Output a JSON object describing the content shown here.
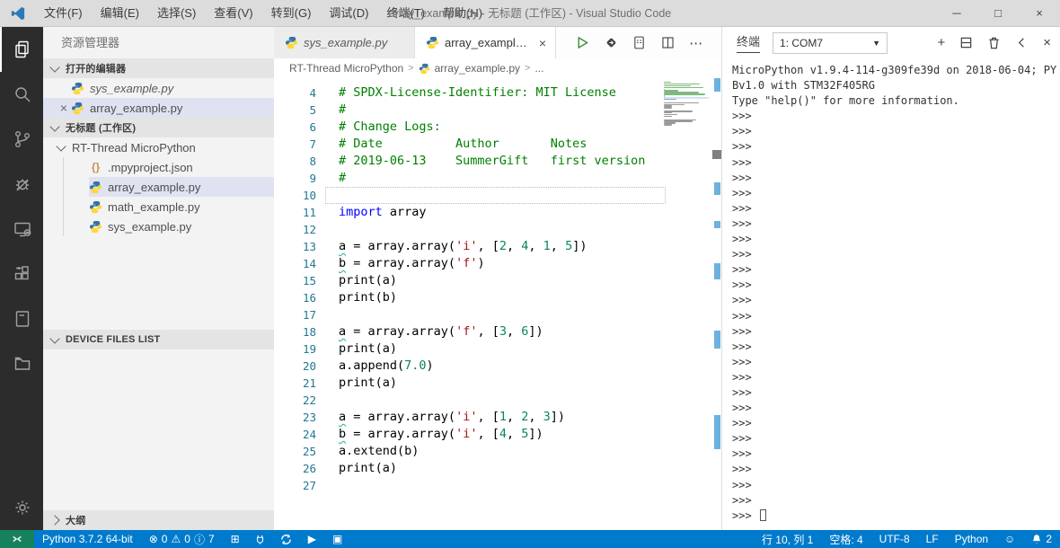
{
  "colors": {
    "accent": "#007acc",
    "remote_green": "#16825d",
    "comment_green": "#008000",
    "keyword_blue": "#0000ff",
    "string_red": "#a31515",
    "number_green": "#098658",
    "squiggle_teal": "#2aa7a4",
    "python_blue": "#3672a4",
    "python_yellow": "#fdd835"
  },
  "glyphs": {
    "close": "×",
    "minimize": "─",
    "maximize": "□",
    "dropdown_arrow": "▼",
    "plus": "+",
    "more_actions": "⋯",
    "error": "⊗",
    "warning": "⚠",
    "info": "ⓘ",
    "new_window": "⊞",
    "play": "▶",
    "stop": "▣",
    "smiley": "☺",
    "breadcrumb_sep": ">"
  },
  "title_bar": {
    "menus": [
      "文件(F)",
      "编辑(E)",
      "选择(S)",
      "查看(V)",
      "转到(G)",
      "调试(D)",
      "终端(T)",
      "帮助(H)"
    ],
    "title": "array_example.py - 无标题 (工作区) - Visual Studio Code"
  },
  "activity_bar": {
    "items": [
      {
        "name": "explorer",
        "active": true
      },
      {
        "name": "search",
        "active": false
      },
      {
        "name": "source-control",
        "active": false
      },
      {
        "name": "debug",
        "active": false
      },
      {
        "name": "device-monitor",
        "active": false
      },
      {
        "name": "extensions",
        "active": false
      },
      {
        "name": "notebook",
        "active": false
      },
      {
        "name": "device-folder",
        "active": false
      }
    ],
    "settings": {
      "name": "settings-gear"
    }
  },
  "sidebar": {
    "title": "资源管理器",
    "open_editors": {
      "header": "打开的编辑器",
      "items": [
        {
          "name": "sys_example.py",
          "preview": true,
          "selected": false,
          "close_visible": false
        },
        {
          "name": "array_example.py",
          "preview": false,
          "selected": true,
          "close_visible": true
        }
      ]
    },
    "workspace": {
      "header": "无标题 (工作区)",
      "folder": "RT-Thread MicroPython",
      "files": [
        {
          "name": ".mpyproject.json",
          "type": "json",
          "selected": false
        },
        {
          "name": "array_example.py",
          "type": "python",
          "selected": true
        },
        {
          "name": "math_example.py",
          "type": "python",
          "selected": false
        },
        {
          "name": "sys_example.py",
          "type": "python",
          "selected": false
        }
      ]
    },
    "device_files": {
      "header": "DEVICE FILES LIST"
    },
    "outline": {
      "header": "大纲"
    }
  },
  "editor": {
    "tabs": [
      {
        "label": "sys_example.py",
        "active": false,
        "preview": true
      },
      {
        "label": "array_example.py",
        "active": true,
        "preview": false
      }
    ],
    "breadcrumb": {
      "folder": "RT-Thread MicroPython",
      "file": "array_example.py",
      "more": "..."
    },
    "minimap_leading_comment_rows": 3,
    "lines": [
      {
        "num": "4",
        "tokens": [
          {
            "c": "cm",
            "t": "# SPDX-License-Identifier: MIT License"
          }
        ]
      },
      {
        "num": "5",
        "tokens": [
          {
            "c": "cm",
            "t": "#"
          }
        ]
      },
      {
        "num": "6",
        "tokens": [
          {
            "c": "cm",
            "t": "# Change Logs:"
          }
        ]
      },
      {
        "num": "7",
        "tokens": [
          {
            "c": "cm",
            "t": "# Date          Author       Notes"
          }
        ]
      },
      {
        "num": "8",
        "tokens": [
          {
            "c": "cm",
            "t": "# 2019-06-13    SummerGift   first version"
          }
        ]
      },
      {
        "num": "9",
        "tokens": [
          {
            "c": "cm",
            "t": "#"
          }
        ]
      },
      {
        "num": "10",
        "tokens": [],
        "current": true
      },
      {
        "num": "11",
        "tokens": [
          {
            "c": "kw",
            "t": "import"
          },
          {
            "c": "pl",
            "t": " array"
          }
        ]
      },
      {
        "num": "12",
        "tokens": []
      },
      {
        "num": "13",
        "tokens": [
          {
            "c": "sq",
            "t": "a"
          },
          {
            "c": "pl",
            "t": " = array.array("
          },
          {
            "c": "str",
            "t": "'i'"
          },
          {
            "c": "pl",
            "t": ", ["
          },
          {
            "c": "num",
            "t": "2"
          },
          {
            "c": "pl",
            "t": ", "
          },
          {
            "c": "num",
            "t": "4"
          },
          {
            "c": "pl",
            "t": ", "
          },
          {
            "c": "num",
            "t": "1"
          },
          {
            "c": "pl",
            "t": ", "
          },
          {
            "c": "num",
            "t": "5"
          },
          {
            "c": "pl",
            "t": "])"
          }
        ]
      },
      {
        "num": "14",
        "tokens": [
          {
            "c": "sq",
            "t": "b"
          },
          {
            "c": "pl",
            "t": " = array.array("
          },
          {
            "c": "str",
            "t": "'f'"
          },
          {
            "c": "pl",
            "t": ")"
          }
        ]
      },
      {
        "num": "15",
        "tokens": [
          {
            "c": "pl",
            "t": "print(a)"
          }
        ]
      },
      {
        "num": "16",
        "tokens": [
          {
            "c": "pl",
            "t": "print(b)"
          }
        ]
      },
      {
        "num": "17",
        "tokens": []
      },
      {
        "num": "18",
        "tokens": [
          {
            "c": "sq",
            "t": "a"
          },
          {
            "c": "pl",
            "t": " = array.array("
          },
          {
            "c": "str",
            "t": "'f'"
          },
          {
            "c": "pl",
            "t": ", ["
          },
          {
            "c": "num",
            "t": "3"
          },
          {
            "c": "pl",
            "t": ", "
          },
          {
            "c": "num",
            "t": "6"
          },
          {
            "c": "pl",
            "t": "])"
          }
        ]
      },
      {
        "num": "19",
        "tokens": [
          {
            "c": "pl",
            "t": "print(a)"
          }
        ]
      },
      {
        "num": "20",
        "tokens": [
          {
            "c": "pl",
            "t": "a.append("
          },
          {
            "c": "num",
            "t": "7.0"
          },
          {
            "c": "pl",
            "t": ")"
          }
        ]
      },
      {
        "num": "21",
        "tokens": [
          {
            "c": "pl",
            "t": "print(a)"
          }
        ]
      },
      {
        "num": "22",
        "tokens": []
      },
      {
        "num": "23",
        "tokens": [
          {
            "c": "sq",
            "t": "a"
          },
          {
            "c": "pl",
            "t": " = array.array("
          },
          {
            "c": "str",
            "t": "'i'"
          },
          {
            "c": "pl",
            "t": ", ["
          },
          {
            "c": "num",
            "t": "1"
          },
          {
            "c": "pl",
            "t": ", "
          },
          {
            "c": "num",
            "t": "2"
          },
          {
            "c": "pl",
            "t": ", "
          },
          {
            "c": "num",
            "t": "3"
          },
          {
            "c": "pl",
            "t": "])"
          }
        ]
      },
      {
        "num": "24",
        "tokens": [
          {
            "c": "sq",
            "t": "b"
          },
          {
            "c": "pl",
            "t": " = array.array("
          },
          {
            "c": "str",
            "t": "'i'"
          },
          {
            "c": "pl",
            "t": ", ["
          },
          {
            "c": "num",
            "t": "4"
          },
          {
            "c": "pl",
            "t": ", "
          },
          {
            "c": "num",
            "t": "5"
          },
          {
            "c": "pl",
            "t": "])"
          }
        ]
      },
      {
        "num": "25",
        "tokens": [
          {
            "c": "pl",
            "t": "a.extend(b)"
          }
        ]
      },
      {
        "num": "26",
        "tokens": [
          {
            "c": "pl",
            "t": "print(a)"
          }
        ]
      },
      {
        "num": "27",
        "tokens": []
      }
    ]
  },
  "terminal": {
    "tab_label": "终端",
    "selector_value": "1: COM7",
    "banner_lines": [
      "MicroPython v1.9.4-114-g309fe39d on 2018-06-04; PY",
      "Bv1.0 with STM32F405RG",
      "Type \"help()\" for more information."
    ],
    "prompt": ">>>",
    "prompt_repeat": 26,
    "last_prompt": ">>>"
  },
  "status_bar": {
    "interpreter": "Python 3.7.2 64-bit",
    "errors": "0",
    "warnings": "0",
    "infos": "7",
    "cursor_position": "行 10, 列 1",
    "indent": "空格: 4",
    "encoding": "UTF-8",
    "eol": "LF",
    "language": "Python",
    "notification_count": "2"
  }
}
